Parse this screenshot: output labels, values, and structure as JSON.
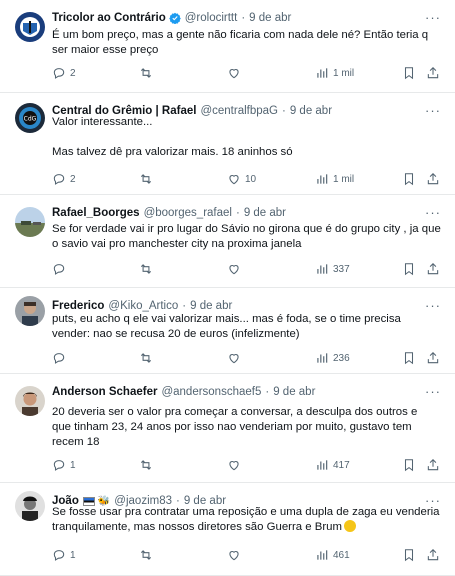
{
  "tweets": [
    {
      "name": "Tricolor ao Contrário",
      "handle": "@rolocirttt",
      "date": "9 de abr",
      "verified": true,
      "lines": [
        "É um bom preço, mas a gente não ficaria com nada dele né? Então teria q",
        "ser maior esse preço"
      ],
      "replies": "2",
      "retweets": "",
      "likes": "",
      "views": "1 mil",
      "avatar": "blue-crest"
    },
    {
      "name": "Central do Grêmio | Rafael",
      "handle": "@centralfbpaG",
      "date": "9 de abr",
      "verified": false,
      "lines": [
        "Valor interessante...",
        "",
        "Mas talvez dê pra valorizar mais. 18 aninhos só"
      ],
      "replies": "2",
      "retweets": "",
      "likes": "10",
      "views": "1 mil",
      "avatar": "cdg-logo"
    },
    {
      "name": "Rafael_Boorges",
      "handle": "@boorges_rafael",
      "date": "9 de abr",
      "verified": false,
      "lines": [
        "Se for verdade vai ir pro lugar do Sávio no girona que é do grupo city , ja que",
        "o savio vai pro manchester city na proxima janela"
      ],
      "replies": "",
      "retweets": "",
      "likes": "",
      "views": "337",
      "avatar": "landscape"
    },
    {
      "name": "Frederico",
      "handle": "@Kiko_Artico",
      "date": "9 de abr",
      "verified": false,
      "lines": [
        "puts, eu acho q ele vai valorizar mais... mas é foda, se o time precisa",
        "vender: nao se recusa 20 de euros (infelizmente)"
      ],
      "replies": "",
      "retweets": "",
      "likes": "",
      "views": "236",
      "avatar": "person-gray"
    },
    {
      "name": "Anderson Schaefer",
      "handle": "@andersonschaef5",
      "date": "9 de abr",
      "verified": false,
      "lines": [
        "20 deveria ser o valor pra começar a conversar, a desculpa dos outros e",
        "que tinham 23, 24 anos por isso nao venderiam por muito, gustavo tem",
        "recem 18"
      ],
      "replies": "1",
      "retweets": "",
      "likes": "",
      "views": "417",
      "avatar": "person-brown"
    },
    {
      "name": "João",
      "handle": "@jaozim83",
      "date": "9 de abr",
      "verified": false,
      "lines": [
        "Se fosse usar pra contratar uma reposição e uma dupla de zaga eu venderia",
        "tranquilamente, mas nossos diretores são Guerra e Brum"
      ],
      "replies": "1",
      "retweets": "",
      "likes": "",
      "views": "461",
      "avatar": "person-bw"
    }
  ],
  "colors": {
    "text": "#0f1419",
    "muted": "#536471",
    "verified": "#1d9bf0",
    "divider": "#e7e9ea"
  },
  "icons": [
    "reply-icon",
    "retweet-icon",
    "like-icon",
    "views-icon",
    "bookmark-icon",
    "share-icon",
    "more-icon",
    "verified-badge-icon"
  ]
}
